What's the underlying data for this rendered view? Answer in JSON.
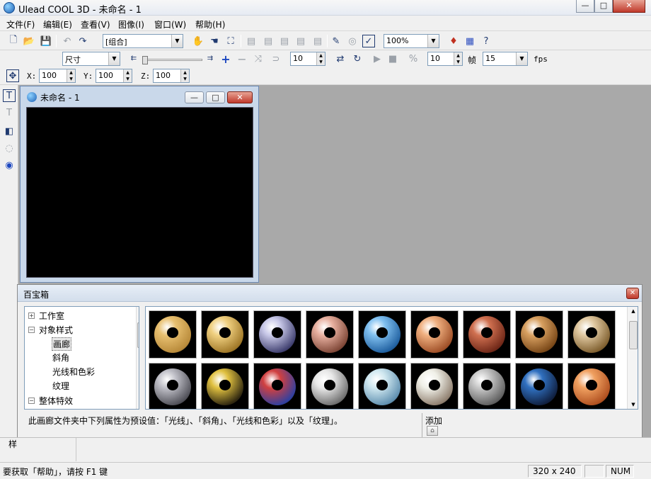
{
  "window": {
    "title": "Ulead COOL 3D - 未命名 - 1",
    "minimize": "—",
    "maximize": "□",
    "close": "✕"
  },
  "menu": [
    "文件(F)",
    "编辑(E)",
    "查看(V)",
    "图像(I)",
    "窗口(W)",
    "帮助(H)"
  ],
  "toolbar": {
    "object_select": "[组合]",
    "zoom": "100%",
    "attr_select": "尺寸",
    "step_value": "10",
    "frame_value": "10",
    "frame_label": "帧",
    "fps_value": "15",
    "fps_label": "fps"
  },
  "position": {
    "x_label": "X:",
    "x": "100",
    "y_label": "Y:",
    "y": "100",
    "z_label": "Z:",
    "z": "100"
  },
  "document": {
    "title": "未命名 - 1"
  },
  "library": {
    "title": "百宝箱",
    "tree": [
      {
        "label": "工作室",
        "expander": "+"
      },
      {
        "label": "对象样式",
        "expander": "−"
      },
      {
        "label": "画廊"
      },
      {
        "label": "斜角"
      },
      {
        "label": "光线和色彩"
      },
      {
        "label": "纹理"
      },
      {
        "label": "整体特效",
        "expander": "−"
      }
    ],
    "description": "此画廊文件夹中下列属性为预设值：「光线」、「斜角」、「光线和色彩」以及「纹理」。",
    "add_label": "添加",
    "thumb_colors": [
      [
        "#e8c070",
        "#b88a3a"
      ],
      [
        "#f0d080",
        "#a07828"
      ],
      [
        "#c8c8e8",
        "#404070"
      ],
      [
        "#e8b0a0",
        "#804838"
      ],
      [
        "#80c0f0",
        "#2060a0"
      ],
      [
        "#f0b080",
        "#a05028"
      ],
      [
        "#d07050",
        "#702818"
      ],
      [
        "#d8a060",
        "#7a4818"
      ],
      [
        "#e0c8a0",
        "#806030"
      ],
      [
        "#c0c0c8",
        "#505058"
      ],
      [
        "#e0c040",
        "#302810"
      ],
      [
        "#d04040",
        "#3040a0"
      ],
      [
        "#e8e8e8",
        "#707070"
      ],
      [
        "#d0e8f0",
        "#6090b0"
      ],
      [
        "#f0f0e8",
        "#908070"
      ],
      [
        "#c8c8c8",
        "#606060"
      ],
      [
        "#3070c0",
        "#102040"
      ],
      [
        "#f0a060",
        "#b05020"
      ]
    ]
  },
  "status": {
    "help": "要获取「帮助」，请按 F1 键",
    "size": "320 x 240",
    "num": "NUM",
    "panel_tab": "样"
  }
}
